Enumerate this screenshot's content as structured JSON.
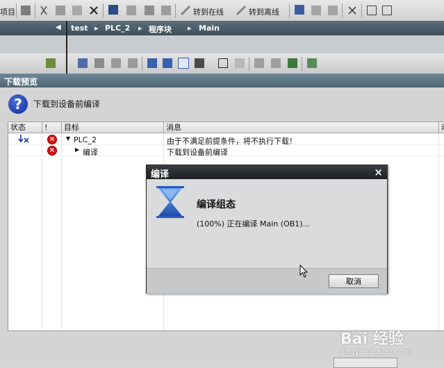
{
  "toolbar": {
    "left_text": "项目",
    "go_online": "转到在线",
    "go_offline": "转到离线"
  },
  "breadcrumb": {
    "items": [
      "test",
      "PLC_2",
      "程序块",
      "Main"
    ]
  },
  "download_preview": {
    "title": "下载预览",
    "message": "下载到设备前编译"
  },
  "table": {
    "headers": [
      "状态",
      "!",
      "目标",
      "消息",
      "动"
    ],
    "rows": [
      {
        "target": "PLC_2",
        "message": "由于不满足前提条件，将不执行下载！"
      },
      {
        "target": "编译",
        "message": "下载到设备前编译"
      }
    ]
  },
  "compile_dialog": {
    "title": "编译",
    "close": "×",
    "heading": "编译组态",
    "status": "(100%) 正在编译 Main (OB1)...",
    "cancel_label": "取消"
  },
  "watermark": {
    "logo": "Bai 经验",
    "url": "jingyan.baidu.com"
  },
  "colors": {
    "breadcrumb_bg": "#4b5d69",
    "header_bg": "#5f7686",
    "error_red": "#d11111",
    "hourglass_blue": "#2a6fd0"
  }
}
